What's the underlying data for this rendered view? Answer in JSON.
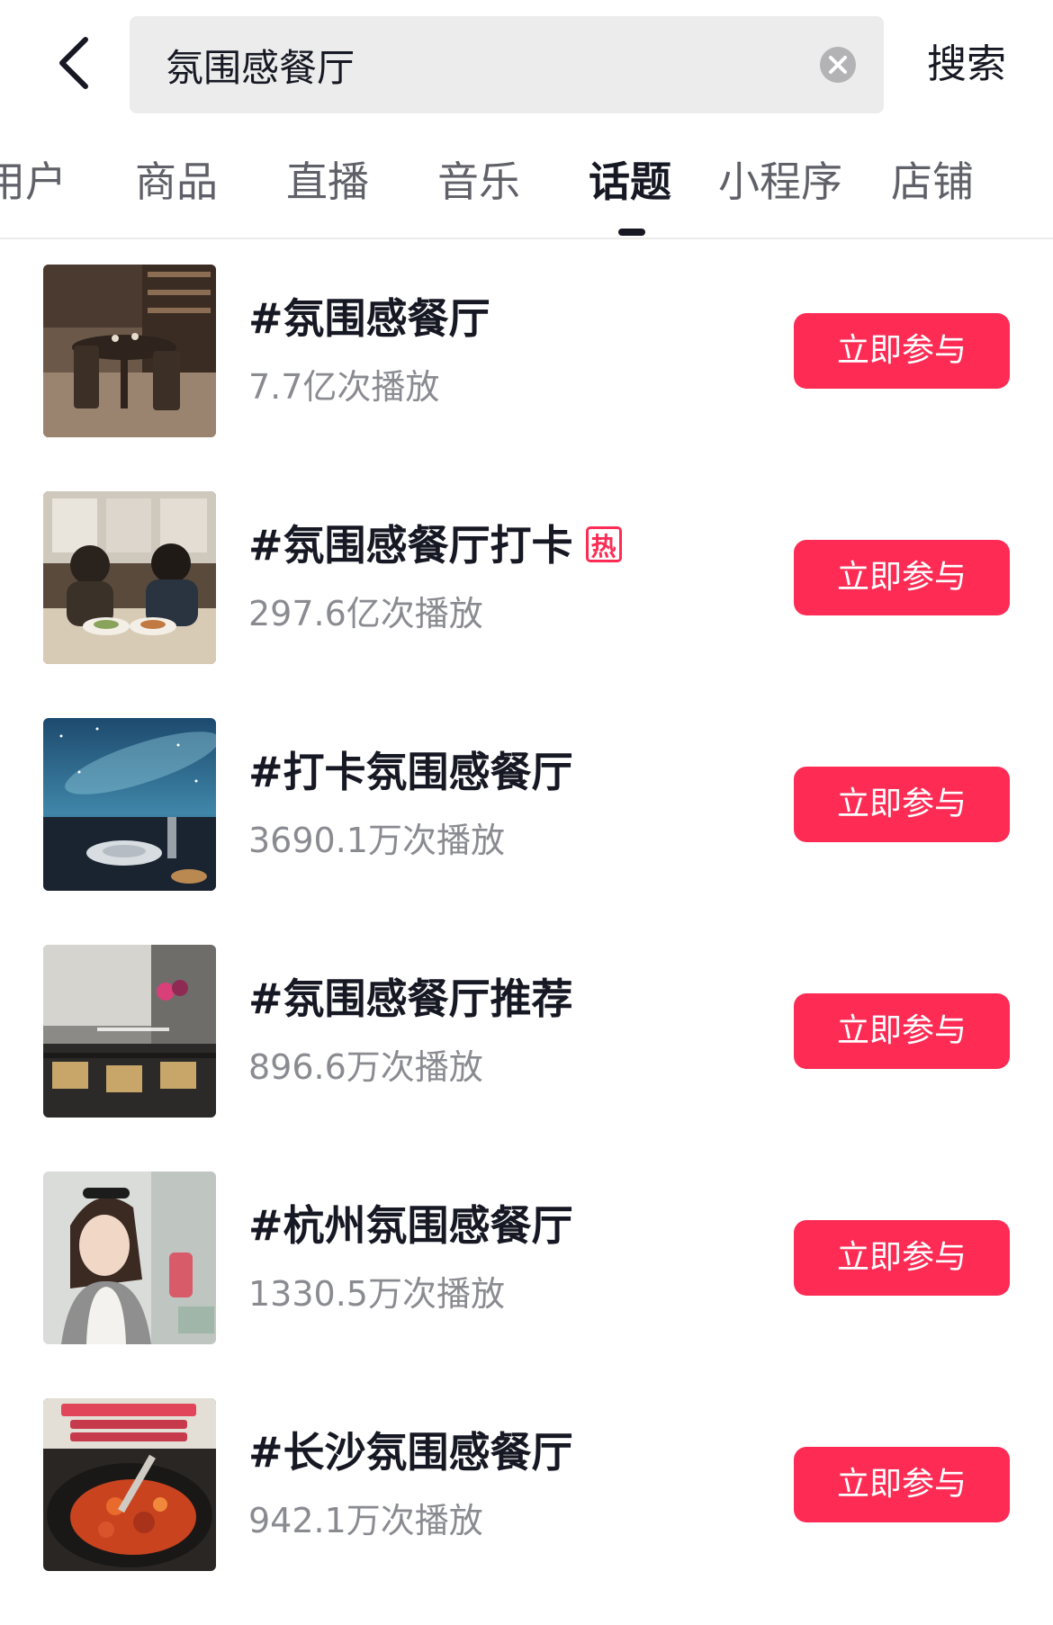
{
  "colors": {
    "accent": "#fe2c55",
    "text_primary": "#161823",
    "text_secondary": "#8a8b91",
    "search_bg": "#ececec"
  },
  "header": {
    "back_icon": "chevron-left-icon",
    "search": {
      "value": "氛围感餐厅",
      "clear_icon": "clear-circle-icon"
    },
    "search_button_label": "搜索"
  },
  "tabs": [
    {
      "label": "用户",
      "active": false
    },
    {
      "label": "商品",
      "active": false
    },
    {
      "label": "直播",
      "active": false
    },
    {
      "label": "音乐",
      "active": false
    },
    {
      "label": "话题",
      "active": true
    },
    {
      "label": "小程序",
      "active": false
    },
    {
      "label": "店铺",
      "active": false
    }
  ],
  "topics": [
    {
      "title": "#氛围感餐厅",
      "plays": "7.7亿次播放",
      "hot": false,
      "button": "立即参与",
      "thumb": "restaurant-interior"
    },
    {
      "title": "#氛围感餐厅打卡",
      "plays": "297.6亿次播放",
      "hot": true,
      "hot_label": "热",
      "button": "立即参与",
      "thumb": "couple-dining"
    },
    {
      "title": "#打卡氛围感餐厅",
      "plays": "3690.1万次播放",
      "hot": false,
      "button": "立即参与",
      "thumb": "starry-sky-table"
    },
    {
      "title": "#氛围感餐厅推荐",
      "plays": "896.6万次播放",
      "hot": false,
      "button": "立即参与",
      "thumb": "dining-room-balloons"
    },
    {
      "title": "#杭州氛围感餐厅",
      "plays": "1330.5万次播放",
      "hot": false,
      "button": "立即参与",
      "thumb": "woman-portrait"
    },
    {
      "title": "#长沙氛围感餐厅",
      "plays": "942.1万次播放",
      "hot": false,
      "button": "立即参与",
      "thumb": "spicy-dish"
    }
  ]
}
